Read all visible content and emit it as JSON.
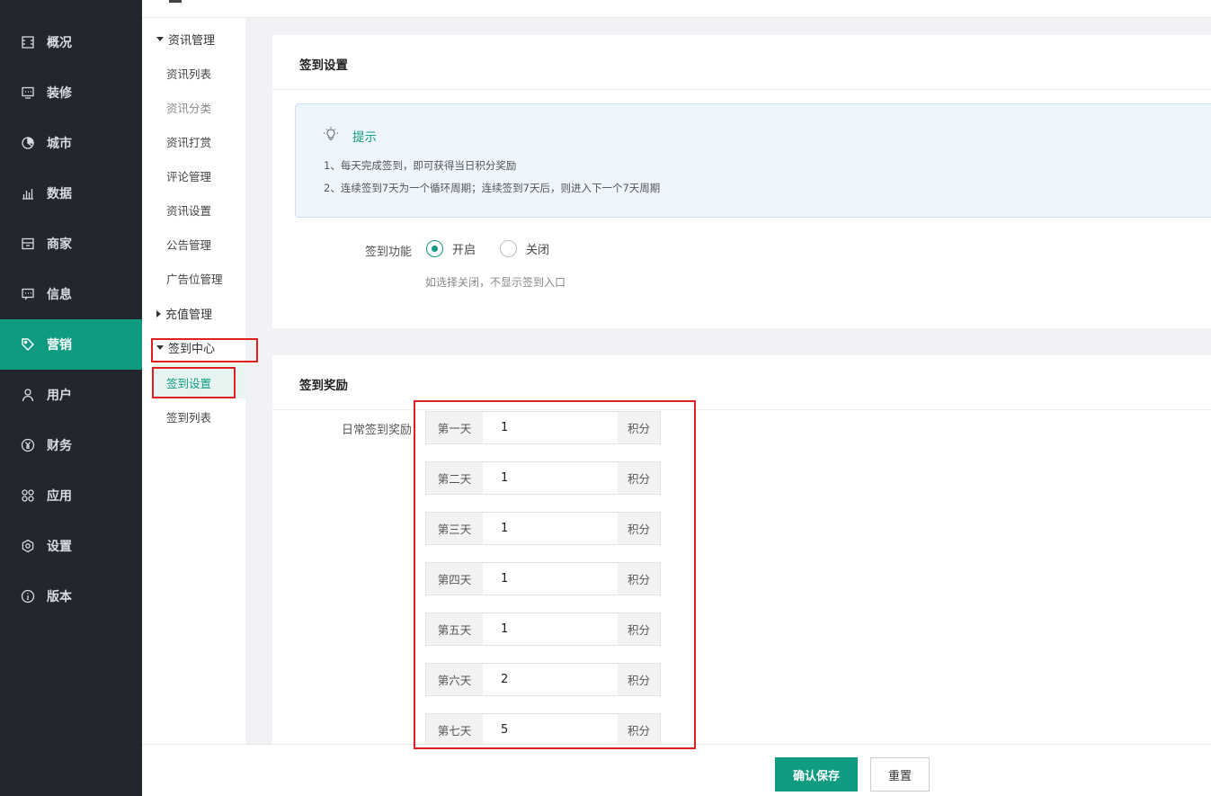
{
  "nav": {
    "items": [
      {
        "label": "概况",
        "icon": "overview-icon"
      },
      {
        "label": "装修",
        "icon": "decorate-icon"
      },
      {
        "label": "城市",
        "icon": "city-icon"
      },
      {
        "label": "数据",
        "icon": "data-icon"
      },
      {
        "label": "商家",
        "icon": "merchant-icon"
      },
      {
        "label": "信息",
        "icon": "message-icon"
      },
      {
        "label": "营销",
        "icon": "tag-icon"
      },
      {
        "label": "用户",
        "icon": "user-icon"
      },
      {
        "label": "财务",
        "icon": "yen-icon"
      },
      {
        "label": "应用",
        "icon": "apps-icon"
      },
      {
        "label": "设置",
        "icon": "gear-icon"
      },
      {
        "label": "版本",
        "icon": "info-icon"
      }
    ],
    "active_index": 6
  },
  "subnav": {
    "group1": "资讯管理",
    "group1_items": [
      "资讯列表",
      "资讯分类",
      "资讯打赏",
      "评论管理",
      "资讯设置",
      "公告管理",
      "广告位管理"
    ],
    "group2": "充值管理",
    "group3": "签到中心",
    "group3_items": [
      "签到设置",
      "签到列表"
    ]
  },
  "settings_card": {
    "title": "签到设置",
    "tip_title": "提示",
    "tip_lines": [
      "1、每天完成签到，即可获得当日积分奖励",
      "2、连续签到7天为一个循环周期；连续签到7天后，则进入下一个7天周期"
    ],
    "function_label": "签到功能",
    "option_on": "开启",
    "option_off": "关闭",
    "selected": "on",
    "hint": "如选择关闭，不显示签到入口"
  },
  "reward_card": {
    "title": "签到奖励",
    "label": "日常签到奖励",
    "unit": "积分",
    "days": [
      {
        "day": "第一天",
        "value": "1"
      },
      {
        "day": "第二天",
        "value": "1"
      },
      {
        "day": "第三天",
        "value": "1"
      },
      {
        "day": "第四天",
        "value": "1"
      },
      {
        "day": "第五天",
        "value": "1"
      },
      {
        "day": "第六天",
        "value": "2"
      },
      {
        "day": "第七天",
        "value": "5"
      }
    ]
  },
  "footer": {
    "save": "确认保存",
    "reset": "重置"
  },
  "colors": {
    "accent": "#0f9b80",
    "sidebar": "#22272e",
    "highlight": "#e02020"
  }
}
